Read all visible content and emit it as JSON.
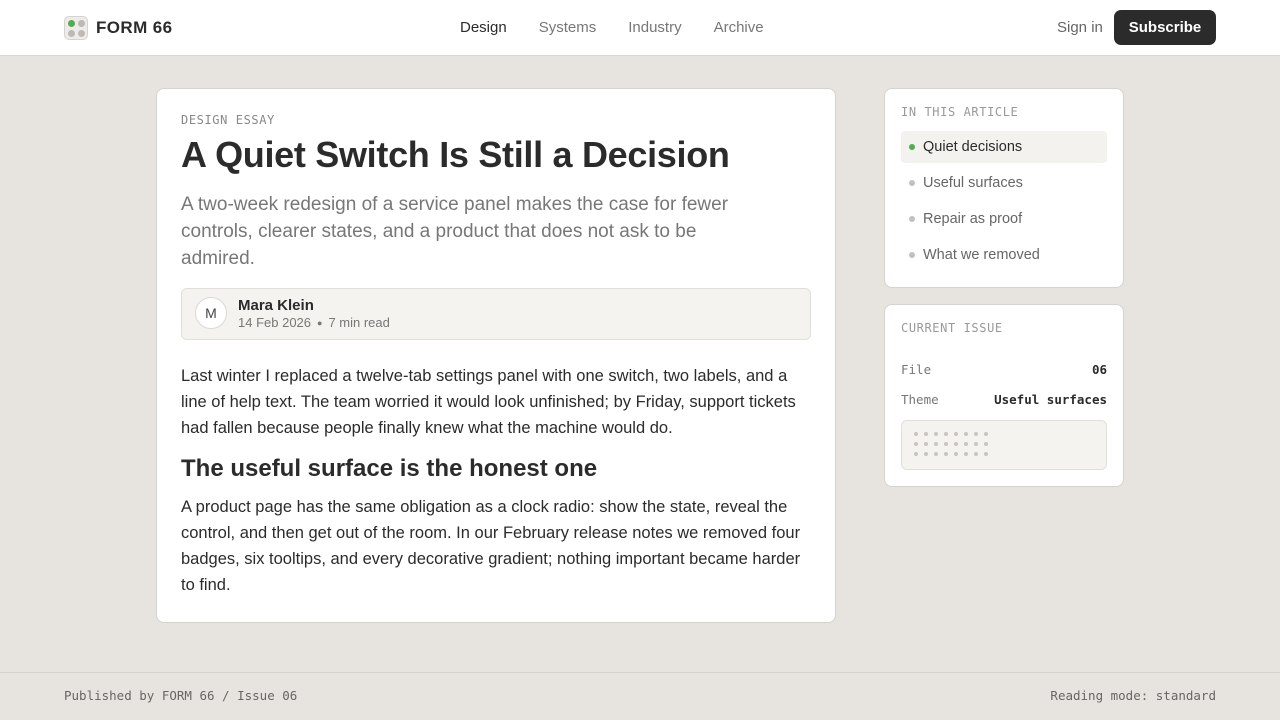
{
  "header": {
    "brand": "FORM 66",
    "nav": [
      {
        "label": "Design",
        "active": true
      },
      {
        "label": "Systems",
        "active": false
      },
      {
        "label": "Industry",
        "active": false
      },
      {
        "label": "Archive",
        "active": false
      }
    ],
    "signin_label": "Sign in",
    "subscribe_label": "Subscribe",
    "logo_icon": "dots-grid-icon"
  },
  "article": {
    "kicker": "DESIGN ESSAY",
    "title": "A Quiet Switch Is Still a Decision",
    "dek": "A two-week redesign of a service panel makes the case for fewer controls, clearer states, and a product that does not ask to be admired.",
    "author": {
      "avatar_initial": "M",
      "name": "Mara Klein",
      "date": "14 Feb 2026",
      "read_time": "7 min read"
    },
    "paragraph_1": "Last winter I replaced a twelve-tab settings panel with one switch, two labels, and a line of help text. The team worried it would look unfinished; by Friday, support tickets had fallen because people finally knew what the machine would do.",
    "heading_2": "The useful surface is the honest one",
    "paragraph_2": "A product page has the same obligation as a clock radio: show the state, reveal the control, and then get out of the room. In our February release notes we removed four badges, six tooltips, and every decorative gradient; nothing important became harder to find."
  },
  "toc": {
    "label": "IN THIS ARTICLE",
    "items": [
      {
        "label": "Quiet decisions",
        "active": true
      },
      {
        "label": "Useful surfaces",
        "active": false
      },
      {
        "label": "Repair as proof",
        "active": false
      },
      {
        "label": "What we removed",
        "active": false
      }
    ]
  },
  "issue": {
    "label": "CURRENT ISSUE",
    "file_key": "File",
    "file_value": "06",
    "theme_key": "Theme",
    "theme_value": "Useful surfaces"
  },
  "footer": {
    "left": "Published by FORM 66 / Issue 06",
    "right": "Reading mode: standard"
  },
  "colors": {
    "accent_green": "#4caf50",
    "dark_button": "#2b2b2b",
    "page_bg": "#e7e4df"
  }
}
